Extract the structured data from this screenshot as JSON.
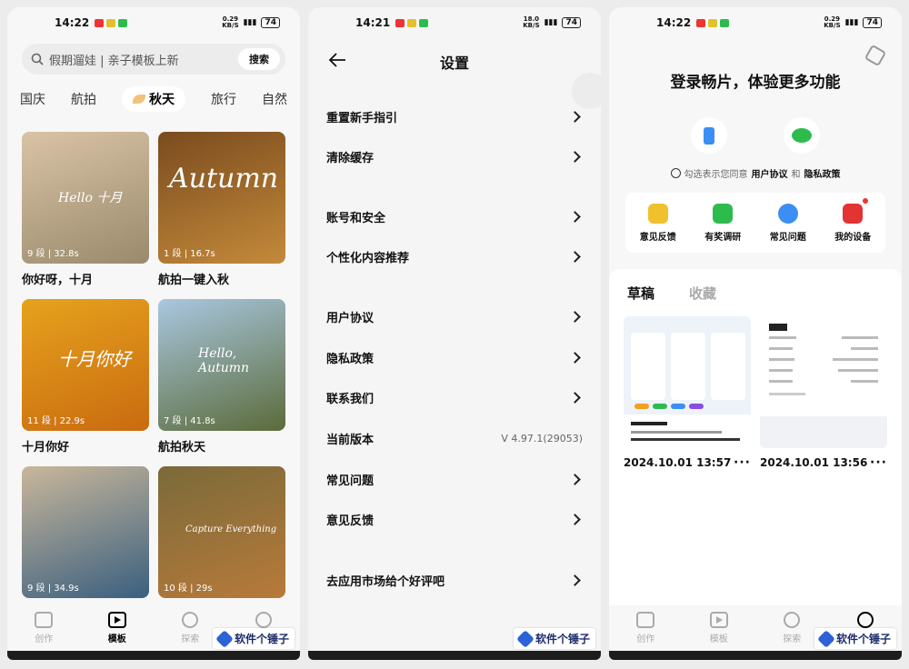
{
  "colors": {
    "accent": "#2b63d6",
    "red": "#e33333",
    "green": "#2dbb4e",
    "blue": "#3b8ef3"
  },
  "watermark": {
    "text": "软件个锤子"
  },
  "phone1": {
    "status": {
      "time": "14:22",
      "net_top": "0.29",
      "net_bottom": "KB/S",
      "battery": "74"
    },
    "search": {
      "placeholder": "假期遛娃 | 亲子模板上新",
      "button": "搜索"
    },
    "categories": [
      {
        "label": "国庆"
      },
      {
        "label": "航拍"
      },
      {
        "label": "秋天",
        "active": true
      },
      {
        "label": "旅行"
      },
      {
        "label": "自然"
      }
    ],
    "cards": [
      {
        "title": "你好呀，十月",
        "meta": "9 段 | 32.8s",
        "overlay": "Hello 十月",
        "colors": [
          "#d9c3a6",
          "#9a8a6c"
        ]
      },
      {
        "title": "航拍一键入秋",
        "meta": "1 段 | 16.7s",
        "overlay": "Autumn",
        "colors": [
          "#7a4b1e",
          "#c48a3a"
        ]
      },
      {
        "title": "十月你好",
        "meta": "11 段 | 22.9s",
        "overlay": "十月你好",
        "colors": [
          "#e6a21d",
          "#c96b10"
        ]
      },
      {
        "title": "航拍秋天",
        "meta": "7 段 | 41.8s",
        "overlay": "Hello, Autumn",
        "colors": [
          "#a9c7e0",
          "#5b6b3a"
        ]
      },
      {
        "title": "",
        "meta": "9 段 | 34.9s",
        "overlay": "",
        "colors": [
          "#c9b79b",
          "#3a5f7f"
        ]
      },
      {
        "title": "",
        "meta": "10 段 | 29s",
        "overlay": "Capture Everything",
        "colors": [
          "#7a6a3a",
          "#b87a3a"
        ]
      }
    ],
    "tabs": [
      {
        "label": "创作",
        "icon": "create-icon"
      },
      {
        "label": "模板",
        "icon": "template-icon",
        "active": true
      },
      {
        "label": "探索",
        "icon": "explore-icon"
      },
      {
        "label": "我的",
        "icon": "profile-icon"
      }
    ]
  },
  "phone2": {
    "status": {
      "time": "14:21",
      "net_top": "18.0",
      "net_bottom": "KB/S",
      "battery": "74"
    },
    "title": "设置",
    "items": [
      {
        "label": "重置新手指引"
      },
      {
        "label": "清除缓存"
      },
      {
        "label": "账号和安全"
      },
      {
        "label": "个性化内容推荐"
      },
      {
        "label": "用户协议"
      },
      {
        "label": "隐私政策"
      },
      {
        "label": "联系我们"
      },
      {
        "label": "当前版本",
        "value": "V 4.97.1(29053)"
      },
      {
        "label": "常见问题"
      },
      {
        "label": "意见反馈"
      },
      {
        "label": "去应用市场给个好评吧"
      }
    ]
  },
  "phone3": {
    "status": {
      "time": "14:22",
      "net_top": "0.29",
      "net_bottom": "KB/S",
      "battery": "74"
    },
    "login_title": "登录畅片，体验更多功能",
    "agree": {
      "prefix": "勾选表示您同意",
      "terms": "用户协议",
      "and": "和",
      "privacy": "隐私政策"
    },
    "quick": [
      {
        "label": "意见反馈",
        "icon": "feedback-icon",
        "color": "#f0c12c"
      },
      {
        "label": "有奖调研",
        "icon": "survey-icon",
        "color": "#2dbb4e"
      },
      {
        "label": "常见问题",
        "icon": "help-icon",
        "color": "#3b8ef3"
      },
      {
        "label": "我的设备",
        "icon": "device-icon",
        "color": "#e33333"
      }
    ],
    "draft_tabs": [
      {
        "label": "草稿",
        "active": true
      },
      {
        "label": "收藏"
      }
    ],
    "drafts": [
      {
        "date": "2024.10.01 13:57",
        "more": "···"
      },
      {
        "date": "2024.10.01 13:56",
        "more": "···"
      }
    ],
    "tabs": [
      {
        "label": "创作",
        "icon": "create-icon"
      },
      {
        "label": "模板",
        "icon": "template-icon"
      },
      {
        "label": "探索",
        "icon": "explore-icon"
      },
      {
        "label": "我的",
        "icon": "profile-icon",
        "active": true
      }
    ]
  }
}
